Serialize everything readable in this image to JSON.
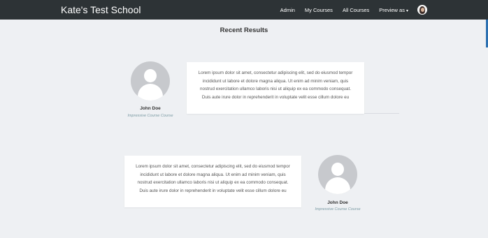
{
  "navbar": {
    "brand": "Kate's Test School",
    "links": [
      "Admin",
      "My Courses",
      "All Courses",
      "Preview as"
    ],
    "caret": "▾"
  },
  "section_title": "Recent Results",
  "results": [
    {
      "name": "John Doe",
      "course": "Impressive Course Course",
      "text": "Lorem ipsum dolor sit amet, consectetur adipiscing elit, sed do eiusmod tempor incididunt ut labore et dolore magna aliqua. Ut enim ad minim veniam, quis nostrud exercitation ullamco laboris nisi ut aliquip ex ea commodo consequat. Duis aute irure dolor in reprehenderit in voluptate velit esse cillum dolore eu"
    },
    {
      "name": "John Doe",
      "course": "Impressive Course Course",
      "text": "Lorem ipsum dolor sit amet, consectetur adipiscing elit, sed do eiusmod tempor incididunt ut labore et dolore magna aliqua. Ut enim ad minim veniam, quis nostrud exercitation ullamco laboris nisi ut aliquip ex ea commodo consequat. Duis aute irure dolor in reprehenderit in voluptate velit esse cillum dolore eu"
    }
  ]
}
